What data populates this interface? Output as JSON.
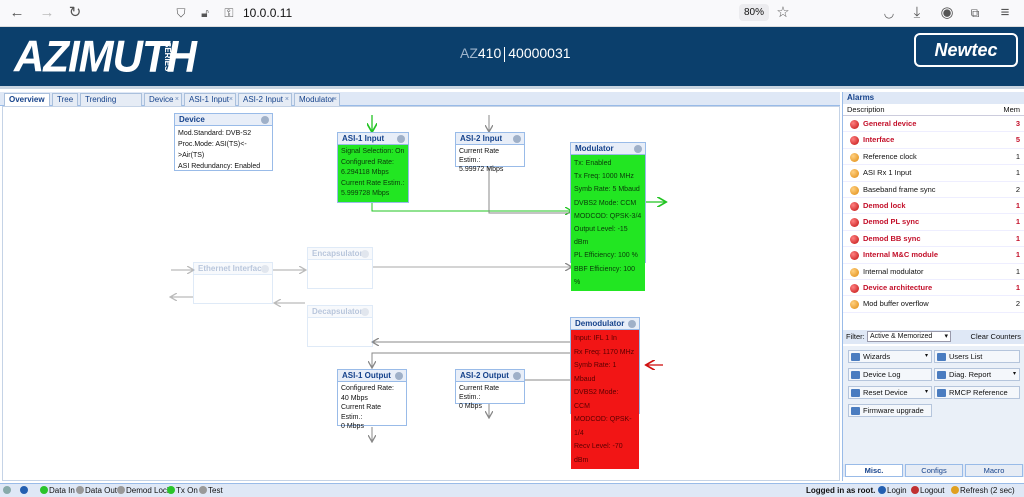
{
  "browser": {
    "url": "10.0.0.11",
    "zoom": "80%"
  },
  "banner": {
    "logo": "AZIMUTH",
    "series": "SERIES",
    "model_prefix": "AZ",
    "model_num": "410",
    "serial": "40000031",
    "brand": "Newtec"
  },
  "tabs": [
    "Overview",
    "Tree",
    "Trending Graphs",
    "Device",
    "ASI-1 Input",
    "ASI-2 Input",
    "Modulator"
  ],
  "blocks": {
    "device": {
      "title": "Device",
      "lines": [
        "Mod.Standard: DVB-S2",
        "Proc.Mode: ASI(TS)<->Air(TS)",
        "ASI Redundancy: Enabled"
      ]
    },
    "asi1_input": {
      "title": "ASI-1 Input",
      "lines": [
        "Signal Selection: On",
        "Configured Rate:",
        "6.294118 Mbps",
        "Current Rate Estim.:",
        "5.999728 Mbps"
      ]
    },
    "asi2_input": {
      "title": "ASI-2 Input",
      "lines": [
        "Current Rate Estim.:",
        "5.99972 Mbps"
      ]
    },
    "modulator": {
      "title": "Modulator",
      "lines": [
        "Tx: Enabled",
        "Tx Freq: 1000 MHz",
        "Symb Rate: 5 Mbaud",
        "DVBS2 Mode: CCM",
        "MODCOD: QPSK-3/4",
        "Output Level: -15 dBm",
        "PL Efficiency: 100 %",
        "BBF Efficiency: 100 %"
      ]
    },
    "ethernet": {
      "title": "Ethernet Interface"
    },
    "encapsulator": {
      "title": "Encapsulator"
    },
    "decapsulator": {
      "title": "Decapsulator"
    },
    "demodulator": {
      "title": "Demodulator",
      "lines": [
        "Input: IFL 1 In",
        "Rx Freq: 1170 MHz",
        "Symb Rate: 1 Mbaud",
        "DVBS2 Mode: CCM",
        "MODCOD: QPSK-1/4",
        "Recv Level: -70 dBm"
      ]
    },
    "asi1_output": {
      "title": "ASI-1 Output",
      "lines": [
        "Configured Rate:",
        "40 Mbps",
        "Current Rate Estim.:",
        "0 Mbps"
      ]
    },
    "asi2_output": {
      "title": "ASI-2 Output",
      "lines": [
        "Current Rate Estim.:",
        "0 Mbps"
      ]
    }
  },
  "alarms": {
    "title": "Alarms",
    "col_description": "Description",
    "col_mem": "Mem",
    "rows": [
      {
        "label": "General device",
        "mem": "3",
        "crit": true
      },
      {
        "label": "Interface",
        "mem": "5",
        "crit": true
      },
      {
        "label": "Reference clock",
        "mem": "1",
        "crit": false
      },
      {
        "label": "ASI Rx 1 Input",
        "mem": "1",
        "crit": false
      },
      {
        "label": "Baseband frame sync",
        "mem": "2",
        "crit": false
      },
      {
        "label": "Demod lock",
        "mem": "1",
        "crit": true
      },
      {
        "label": "Demod PL sync",
        "mem": "1",
        "crit": true
      },
      {
        "label": "Demod BB sync",
        "mem": "1",
        "crit": true
      },
      {
        "label": "Internal M&C module",
        "mem": "1",
        "crit": true
      },
      {
        "label": "Internal modulator",
        "mem": "1",
        "crit": false
      },
      {
        "label": "Device architecture",
        "mem": "1",
        "crit": true
      },
      {
        "label": "Mod buffer overflow",
        "mem": "2",
        "crit": false
      }
    ],
    "filter_label": "Filter:",
    "filter_value": "Active & Memorized",
    "clear": "Clear Counters"
  },
  "tools": {
    "wizards": "Wizards",
    "users_list": "Users List",
    "device_log": "Device Log",
    "diag_report": "Diag. Report",
    "reset_device": "Reset Device",
    "rmcp_reference": "RMCP Reference",
    "firmware_upgrade": "Firmware upgrade"
  },
  "bottom_tabs": [
    "Misc.",
    "Configs",
    "Macro"
  ],
  "status": {
    "data_in": "Data In",
    "data_out": "Data Out",
    "demod_lock": "Demod Lock",
    "tx_on": "Tx On",
    "test": "Test",
    "logged": "Logged in as root.",
    "login": "Login",
    "logout": "Logout",
    "refresh": "Refresh (2 sec)"
  },
  "colors": {
    "banner": "#0b3f6c",
    "ok": "#22e622",
    "alarm": "#f21515",
    "crit_text": "#c3102a",
    "warn": "#f0a020"
  }
}
